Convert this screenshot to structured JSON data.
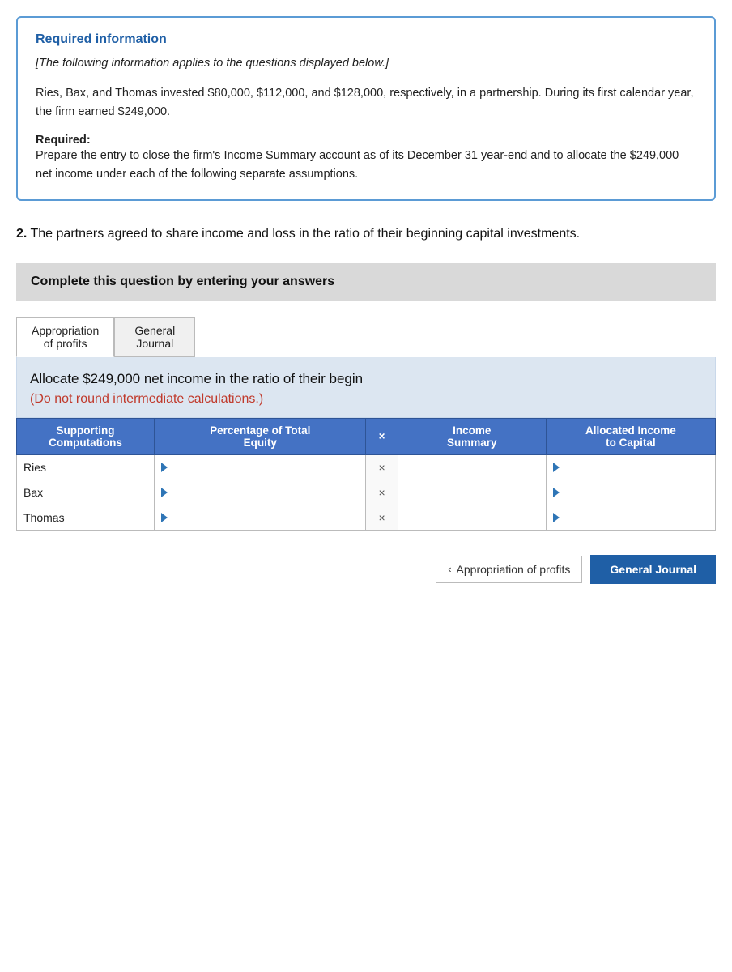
{
  "required_info": {
    "title": "Required information",
    "italic_text": "[The following information applies to the questions displayed below.]",
    "body_text": "Ries, Bax, and Thomas invested $80,000, $112,000, and $128,000, respectively, in a partnership. During its first calendar year, the firm earned $249,000.",
    "required_label": "Required:",
    "required_body": "Prepare the entry to close the firm's Income Summary account as of its December 31 year-end and to allocate the $249,000 net income under each of the following separate assumptions."
  },
  "question2": {
    "number": "2.",
    "text": "The partners agreed to share income and loss in the ratio of their beginning capital investments."
  },
  "complete_banner": {
    "text": "Complete this question by entering your answers"
  },
  "tabs": [
    {
      "label": "Appropriation\nof profits",
      "active": true
    },
    {
      "label": "General\nJournal",
      "active": false
    }
  ],
  "allocate_header": {
    "main_text": "Allocate $249,000 net income in the ratio of their begin",
    "sub_text": "(Do not round intermediate calculations.)"
  },
  "table": {
    "headers": [
      "Supporting\nComputations",
      "Percentage of Total\nEquity",
      "×",
      "Income\nSummary",
      "Allocated Income\nto Capital"
    ],
    "rows": [
      {
        "label": "Ries",
        "percentage": "",
        "mult": "×",
        "income": "",
        "allocated": ""
      },
      {
        "label": "Bax",
        "percentage": "",
        "mult": "×",
        "income": "",
        "allocated": ""
      },
      {
        "label": "Thomas",
        "percentage": "",
        "mult": "×",
        "income": "",
        "allocated": ""
      }
    ]
  },
  "nav": {
    "prev_label": "‹",
    "appropriation_label": "Appropriation of profits",
    "general_journal_label": "General Journal"
  }
}
